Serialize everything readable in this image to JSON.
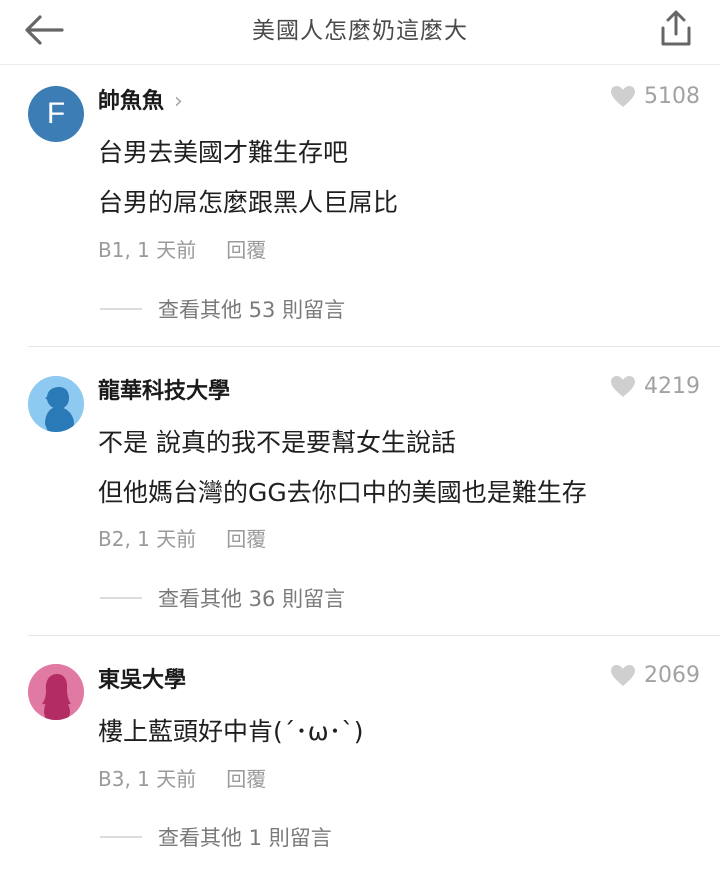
{
  "header": {
    "title": "美國人怎麼奶這麼大",
    "back_icon": "arrow-left-icon",
    "share_icon": "share-upload-icon"
  },
  "comments": [
    {
      "author": "帥魚魚",
      "avatar_letter": "F",
      "avatar_color": "#3d7db6",
      "likes": "5108",
      "lines": [
        "台男去美國才難生存吧",
        "台男的屌怎麼跟黑人巨屌比"
      ],
      "floor_time": "B1, 1 天前",
      "reply_label": "回覆",
      "more_replies": "查看其他 53 則留言"
    },
    {
      "author": "龍華科技大學",
      "avatar_color": "#8ec9f1",
      "likes": "4219",
      "lines": [
        "不是 說真的我不是要幫女生說話",
        "但他媽台灣的GG去你口中的美國也是難生存"
      ],
      "floor_time": "B2, 1 天前",
      "reply_label": "回覆",
      "more_replies": "查看其他 36 則留言"
    },
    {
      "author": "東吳大學",
      "avatar_color": "#e07aa3",
      "likes": "2069",
      "lines": [
        "樓上藍頭好中肯(´･ω･`)"
      ],
      "floor_time": "B3, 1 天前",
      "reply_label": "回覆",
      "more_replies": "查看其他 1 則留言"
    }
  ]
}
